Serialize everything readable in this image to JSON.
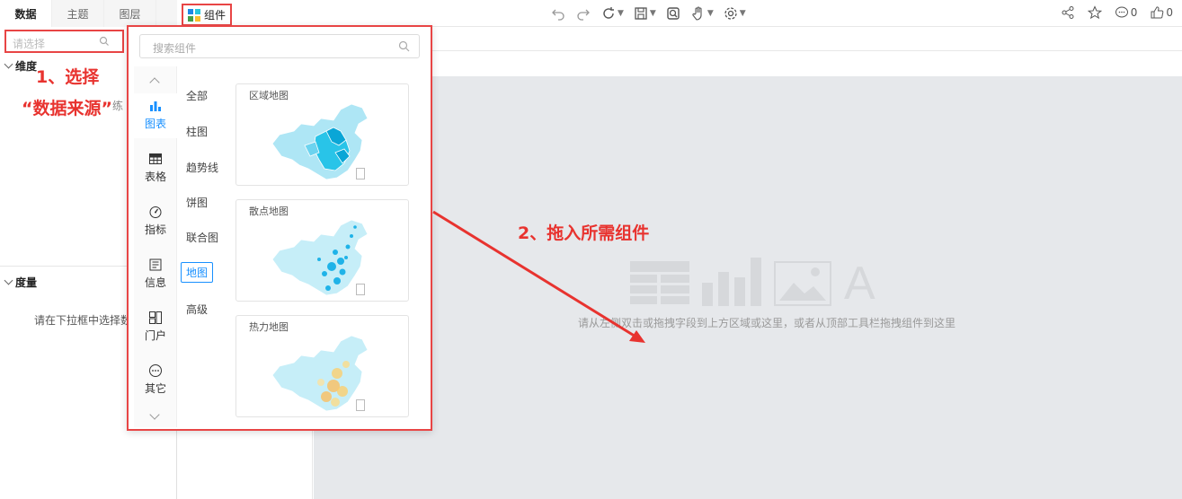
{
  "left_tabs": [
    "数据",
    "主题",
    "图层"
  ],
  "component_button": {
    "label": "组件"
  },
  "toolbar": {
    "comments_count": "0",
    "likes_count": "0"
  },
  "datasource": {
    "placeholder": "请选择"
  },
  "dimension": {
    "title": "维度"
  },
  "measure": {
    "title": "度量",
    "hint": "请在下拉框中选择数"
  },
  "annotations": {
    "step1_line1": "1、选择",
    "step1_line2": "“数据来源”",
    "step1_tail": "练",
    "step2": "2、拖入所需组件"
  },
  "popup": {
    "search_placeholder": "搜索组件",
    "nav": [
      {
        "label": "图表",
        "icon": "bar-chart-icon"
      },
      {
        "label": "表格",
        "icon": "table-icon"
      },
      {
        "label": "指标",
        "icon": "gauge-icon"
      },
      {
        "label": "信息",
        "icon": "info-icon"
      },
      {
        "label": "门户",
        "icon": "portal-icon"
      },
      {
        "label": "其它",
        "icon": "more-icon"
      }
    ],
    "categories": [
      "全部",
      "柱图",
      "趋势线",
      "饼图",
      "联合图",
      "地图",
      "高级"
    ],
    "selected_category": "地图",
    "cards": [
      {
        "title": "区域地图"
      },
      {
        "title": "散点地图"
      },
      {
        "title": "热力地图"
      }
    ]
  },
  "canvas": {
    "hint": "请从左侧双击或拖拽字段到上方区域或这里，或者从顶部工具栏拖拽组件到这里",
    "placeholder_letter": "A"
  },
  "colors": {
    "accent": "#1890ff",
    "annotation_red": "#e8332f",
    "canvas_bg": "#e6e8eb"
  }
}
